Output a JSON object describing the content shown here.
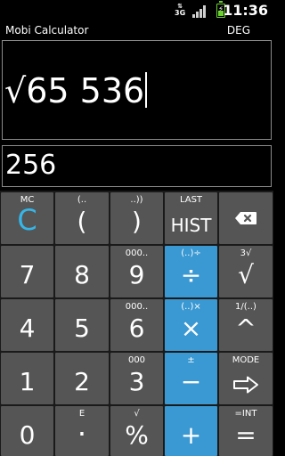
{
  "status_bar": {
    "network": "3G",
    "time": "11:36"
  },
  "header": {
    "title": "Mobi Calculator",
    "angle_mode": "DEG"
  },
  "display": {
    "expression": "√65 536",
    "result": "256"
  },
  "keys": {
    "mc": {
      "sec": "MC",
      "main": "C"
    },
    "open_paren": {
      "sec": "(..",
      "main": "("
    },
    "close_paren": {
      "sec": "..))",
      "main": ")"
    },
    "hist": {
      "sec": "LAST",
      "main": "HIST"
    },
    "k7": {
      "main": "7"
    },
    "k8": {
      "main": "8"
    },
    "k9": {
      "sec": "000..",
      "main": "9"
    },
    "divide": {
      "sec": "(..)÷",
      "main": "÷"
    },
    "root": {
      "sec": "3√",
      "main": "√"
    },
    "k4": {
      "main": "4"
    },
    "k5": {
      "main": "5"
    },
    "k6": {
      "sec": "000..",
      "main": "6"
    },
    "multiply": {
      "sec": "(..)×",
      "main": "×"
    },
    "power": {
      "sec": "1/(..)",
      "main": "^"
    },
    "k1": {
      "main": "1"
    },
    "k2": {
      "main": "2"
    },
    "k3": {
      "sec": "000",
      "main": "3"
    },
    "minus": {
      "sec": "±",
      "main": "−"
    },
    "mode": {
      "sec": "MODE"
    },
    "k0": {
      "main": "0"
    },
    "dot": {
      "sec": "E",
      "main": "·"
    },
    "percent": {
      "sec": "√",
      "main": "%"
    },
    "plus": {
      "main": "+"
    },
    "equals": {
      "sec": "=INT",
      "main": "="
    }
  },
  "colors": {
    "accent_blue": "#3a98d2",
    "key_gray": "#555555",
    "clear_cyan": "#36b6e8",
    "battery_green": "#6bd12f"
  }
}
